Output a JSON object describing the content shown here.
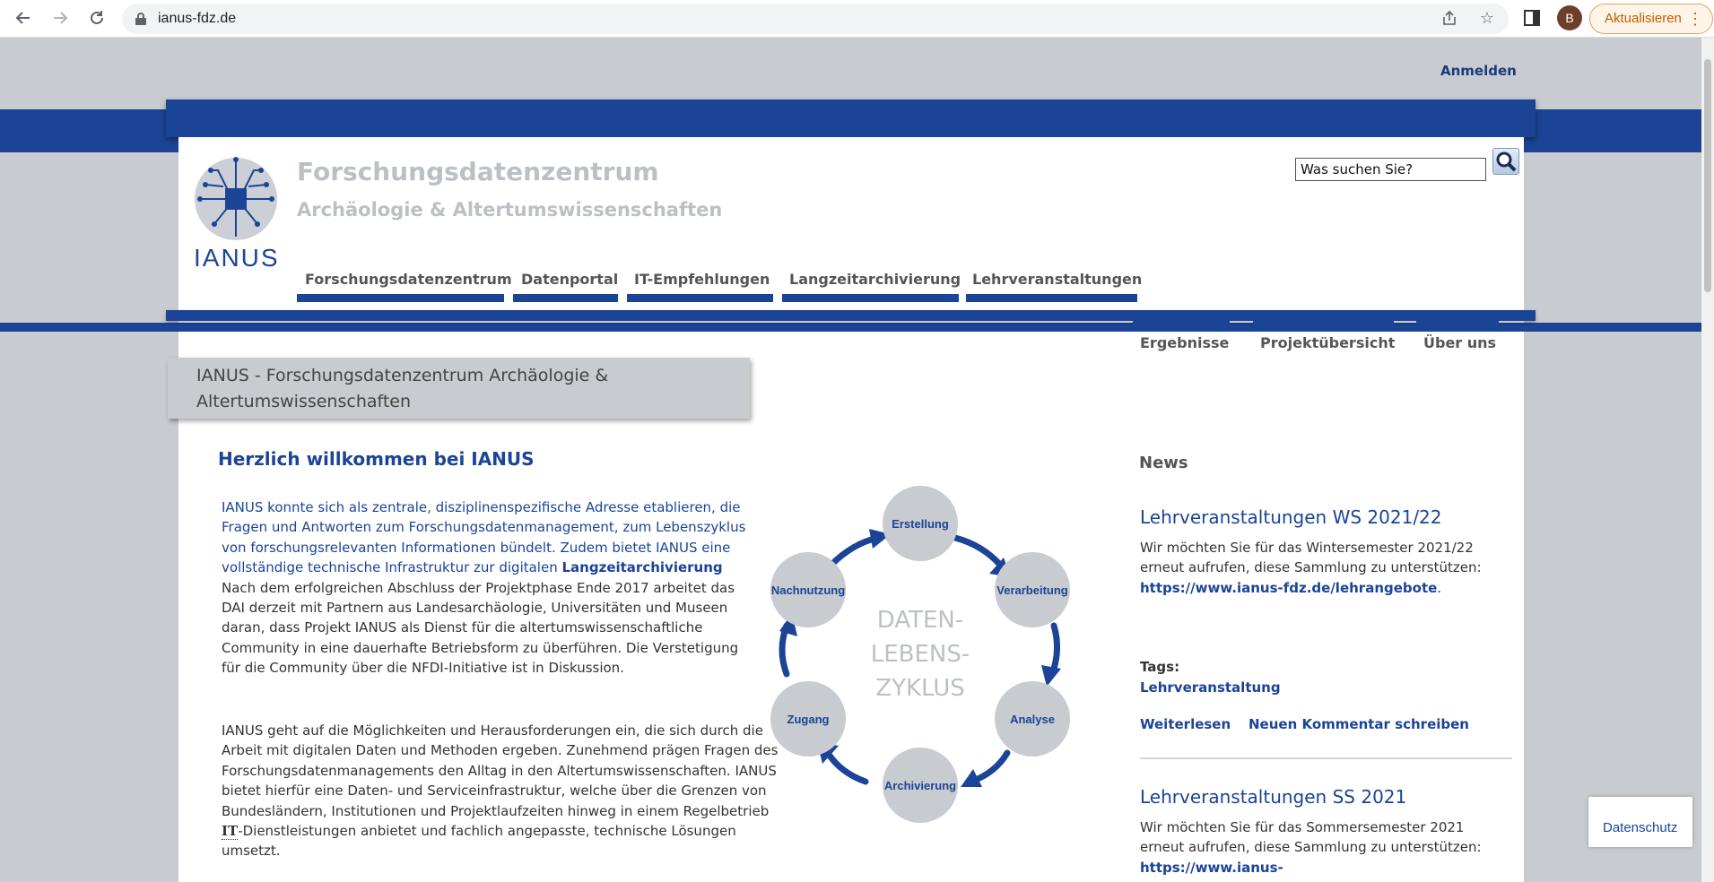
{
  "browser": {
    "url": "ianus-fdz.de",
    "profile_initial": "B",
    "update_label": "Aktualisieren"
  },
  "header": {
    "login": "Anmelden",
    "logo_text": "IANUS",
    "site_title": "Forschungsdatenzentrum",
    "site_subtitle": "Archäologie & Altertumswissenschaften",
    "search_placeholder": "Was suchen Sie?"
  },
  "main_nav": [
    {
      "label": "Forschungsdatenzentrum"
    },
    {
      "label": "Datenportal"
    },
    {
      "label": "IT-Empfehlungen"
    },
    {
      "label": "Langzeitarchivierung"
    },
    {
      "label": "Lehrveranstaltungen"
    }
  ],
  "sub_nav": [
    {
      "label": "Ergebnisse"
    },
    {
      "label": "Projektübersicht"
    },
    {
      "label": "Über uns"
    }
  ],
  "page_title": "IANUS - Forschungsdatenzentrum Archäologie & Altertumswissenschaften",
  "content": {
    "welcome": "Herzlich willkommen bei IANUS",
    "intro_blue": "IANUS konnte sich als zentrale, disziplinenspezifische Adresse etablieren, die Fragen und Antworten zum Forschungsdatenmanagement, zum Lebenszyklus von forschungsrelevanten Informationen bündelt. Zudem bietet IANUS eine vollständige technische Infrastruktur zur digitalen",
    "intro_strong": "Langzeitarchivierung",
    "intro_rest": " Nach dem erfolgreichen Abschluss der Projektphase Ende 2017 arbeitet das DAI derzeit mit Partnern aus Landesarchäologie, Universitäten und Museen daran, dass Projekt IANUS als Dienst für die altertumswissenschaftliche Community in eine dauerhafte Betriebsform zu überführen. Die Verstetigung für die Community über die NFDI-Initiative ist in Diskussion.",
    "para2_a": "IANUS geht auf die Möglichkeiten und Herausforderungen ein, die sich durch die Arbeit mit digitalen Daten und Methoden ergeben. Zunehmend prägen Fragen des Forschungsdatenmanagements den Alltag in den Altertumswissenschaften. IANUS bietet hierfür eine Daten- und Serviceinfrastruktur, welche über die Grenzen von Bundesländern, Institutionen und Projektlaufzeiten hinweg in einem Regelbetrieb ",
    "para2_abbr": "IT",
    "para2_b": "-Dienstleistungen anbietet und fachlich angepasste, technische Lösungen umsetzt."
  },
  "lifecycle": {
    "center_lines": [
      "DATEN-",
      "LEBENS-",
      "ZYKLUS"
    ],
    "stages": [
      "Erstellung",
      "Verarbeitung",
      "Analyse",
      "Archivierung",
      "Zugang",
      "Nachnutzung"
    ]
  },
  "news": {
    "heading": "News",
    "items": [
      {
        "title": "Lehrveranstaltungen WS 2021/22",
        "text": "Wir möchten Sie für das Wintersemester 2021/22 erneut aufrufen, diese Sammlung zu unterstützen: ",
        "link": "https://www.ianus-fdz.de/lehrangebote",
        "after": "."
      },
      {
        "title": "Lehrveranstaltungen SS 2021",
        "text": "Wir möchten Sie für das Sommersemester 2021 erneut aufrufen, diese Sammlung zu unterstützen: ",
        "link": "https://www.ianus-"
      }
    ],
    "tags_label": "Tags:",
    "tag": "Lehrveranstaltung",
    "read_more": "Weiterlesen",
    "new_comment": "Neuen Kommentar schreiben"
  },
  "privacy": "Datenschutz",
  "colors": {
    "brand_blue": "#1b4496",
    "background_grey": "#c8cbcf",
    "title_grey": "#bcc0c5",
    "update_orange": "#c25b00"
  }
}
